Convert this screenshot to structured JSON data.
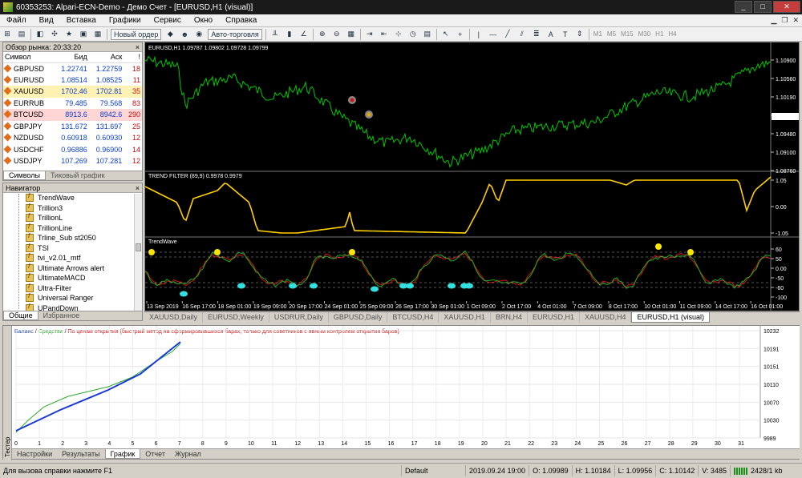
{
  "window": {
    "title": "60353253: Alpari-ECN-Demo - Демо Счет - [EURUSD,H1 (visual)]",
    "controls": [
      "_",
      "□",
      "✕"
    ]
  },
  "menu": [
    "Файл",
    "Вид",
    "Вставка",
    "Графики",
    "Сервис",
    "Окно",
    "Справка"
  ],
  "toolbar": {
    "new_order": "Новый ордер",
    "autotrading": "Авто-торговля",
    "timeframes": [
      "M1",
      "M5",
      "M15",
      "M30",
      "H1",
      "H4"
    ]
  },
  "market_watch": {
    "title": "Обзор рынка: 20:33:20",
    "columns": [
      "Символ",
      "Бид",
      "Аск",
      "!"
    ],
    "rows": [
      [
        "GBPUSD",
        "1.22741",
        "1.22759",
        "18"
      ],
      [
        "EURUSD",
        "1.08514",
        "1.08525",
        "11"
      ],
      [
        "XAUUSD",
        "1702.46",
        "1702.81",
        "35"
      ],
      [
        "EURRUB",
        "79.485",
        "79.568",
        "83"
      ],
      [
        "BTCUSD",
        "8913.6",
        "8942.6",
        "290"
      ],
      [
        "GBPJPY",
        "131.672",
        "131.697",
        "25"
      ],
      [
        "NZDUSD",
        "0.60918",
        "0.60930",
        "12"
      ],
      [
        "USDCHF",
        "0.96886",
        "0.96900",
        "14"
      ],
      [
        "USDJPY",
        "107.269",
        "107.281",
        "12"
      ]
    ],
    "tabs": [
      "Символы",
      "Тиковый график"
    ]
  },
  "navigator": {
    "title": "Навигатор",
    "items": [
      "TrendWave",
      "Trillion3",
      "TrillionL",
      "TrillionLine",
      "Trline_Sub st2050",
      "TSI",
      "tvi_v2.01_mtf",
      "Ultimate Arrows alert",
      "UltimateMACD",
      "Ultra-Filter",
      "Universal Ranger",
      "UPandDown"
    ],
    "tabs": [
      "Общие",
      "Избранное"
    ]
  },
  "chart": {
    "symbol_label": "EURUSD,H1  1.09787  1.09802  1.09728  1.09799",
    "price_ticks": [
      "1.10900",
      "1.10560",
      "1.10190",
      "1.09799",
      "1.09480",
      "1.09100",
      "1.08760"
    ],
    "filter_label": "TREND FILTER (89,9) 0.9978 0.9979",
    "filter_ticks": [
      "1.05",
      "0.00",
      "-1.05"
    ],
    "wave_label": "TrendWave",
    "wave_ticks": [
      "60",
      "50",
      "0.00",
      "-50",
      "-60",
      "-100"
    ],
    "time_ticks": [
      "13 Sep 2019",
      "16 Sep 17:00",
      "18 Sep 01:00",
      "19 Sep 09:00",
      "20 Sep 17:00",
      "24 Sep 01:00",
      "25 Sep 09:00",
      "26 Sep 17:00",
      "30 Sep 01:00",
      "1 Oct 09:00",
      "2 Oct 17:00",
      "4 Oct 01:00",
      "7 Oct 09:00",
      "8 Oct 17:00",
      "10 Oct 01:00",
      "11 Oct 09:00",
      "14 Oct 17:00",
      "16 Oct 01:00"
    ],
    "tabs": [
      "XAUUSD,Daily",
      "EURUSD,Weekly",
      "USDRUR,Daily",
      "GBPUSD,Daily",
      "BTCUSD,H4",
      "XAUUSD,H1",
      "BRN,H4",
      "EURUSD,H1",
      "XAUUSD,H4",
      "EURUSD,H1 (visual)"
    ]
  },
  "tester": {
    "side_label": "Тестер",
    "legend": {
      "balance": "Баланс",
      "equity": "Средства",
      "desc": "По ценам открытия (быстрый метод на сформировавшихся барах, только для советников с явным контролем открытия баров)"
    },
    "y_ticks": [
      "10232",
      "10191",
      "10151",
      "10110",
      "10070",
      "10030",
      "9989"
    ],
    "x_ticks": [
      "0",
      "1",
      "2",
      "3",
      "4",
      "5",
      "6",
      "7",
      "8",
      "9",
      "10",
      "11",
      "12",
      "13",
      "14",
      "15",
      "16",
      "17",
      "18",
      "19",
      "20",
      "21",
      "22",
      "23",
      "24",
      "25",
      "26",
      "27",
      "28",
      "29",
      "30",
      "31"
    ],
    "tabs": [
      "Настройки",
      "Результаты",
      "График",
      "Отчет",
      "Журнал"
    ]
  },
  "status": {
    "help": "Для вызова справки нажмите F1",
    "profile": "Default",
    "time": "2019.09.24 19:00",
    "open": "O: 1.09989",
    "high": "H: 1.10184",
    "low": "L: 1.09956",
    "close": "C: 1.10142",
    "volume": "V: 3485",
    "traffic": "2428/1 kb"
  },
  "colors": {
    "price": "#00c400",
    "wave_red": "#d21414",
    "wave_green": "#1faf1f",
    "marker_yellow": "#ffe600",
    "marker_cyan": "#33e0e0",
    "balance": "#1a3ad8",
    "equity": "#2eaa2e"
  }
}
